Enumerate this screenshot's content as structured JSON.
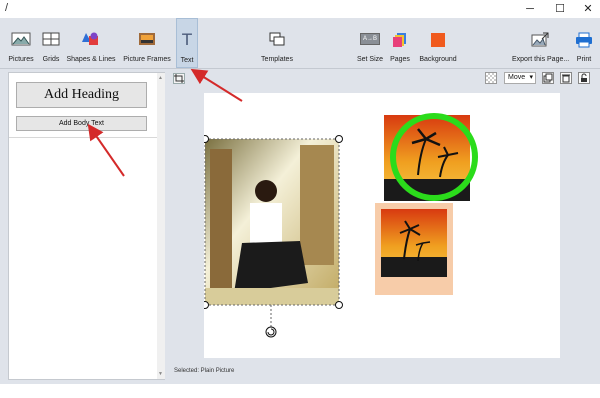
{
  "window": {
    "left_mark": "/",
    "minimize_glyph": "─",
    "maximize_glyph": "☐",
    "close_glyph": "✕"
  },
  "ribbon": {
    "items": [
      {
        "label": "Pictures",
        "icon": "pictures-icon"
      },
      {
        "label": "Grids",
        "icon": "grids-icon"
      },
      {
        "label": "Shapes & Lines",
        "icon": "shapes-lines-icon"
      },
      {
        "label": "Picture Frames",
        "icon": "picture-frames-icon"
      },
      {
        "label": "Text",
        "icon": "text-icon",
        "active": true
      },
      {
        "label": "Templates",
        "icon": "templates-icon"
      },
      {
        "label": "Set Size",
        "icon": "set-size-icon"
      },
      {
        "label": "Pages",
        "icon": "pages-icon"
      },
      {
        "label": "Background",
        "icon": "background-icon"
      },
      {
        "label": "Export this Page...",
        "icon": "export-icon"
      },
      {
        "label": "Print",
        "icon": "print-icon"
      }
    ],
    "text_glyph": "T",
    "set_size_glyph": "A→B"
  },
  "left_panel": {
    "add_heading": "Add Heading",
    "add_body_text": "Add Body Text",
    "scroll_up": "▲",
    "scroll_down": "▼"
  },
  "canvas_toolbar": {
    "mode_value": "Move",
    "mode_caret": "▾"
  },
  "status_bar": {
    "selected_text": "Selected: Plain Picture"
  },
  "colors": {
    "accent_red": "#d42a2a",
    "circle_green": "#2bdc1b",
    "frame_peach": "#f7cca9",
    "background_orange": "#f05a1e",
    "print_blue": "#1f6fd1"
  }
}
